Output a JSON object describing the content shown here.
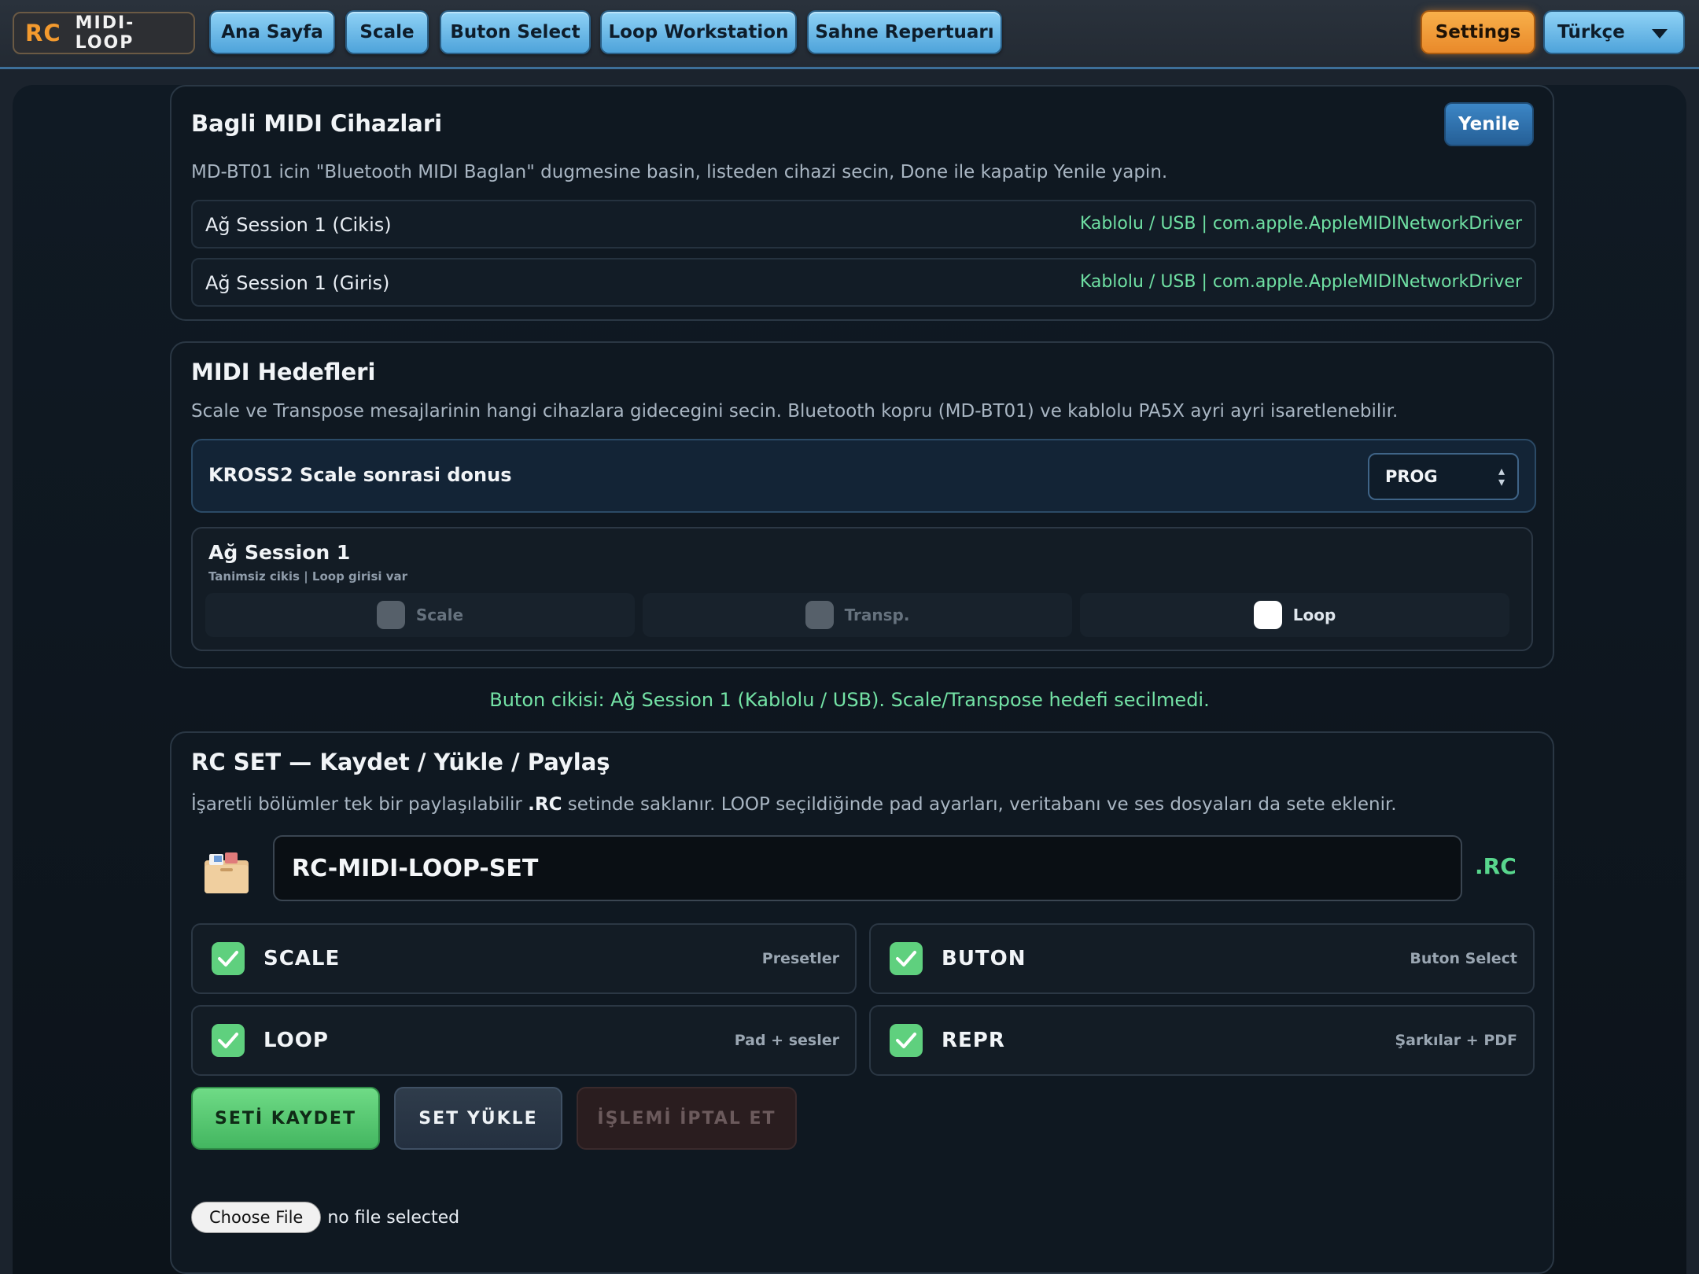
{
  "brand": {
    "logo": "RC",
    "name": "MIDI-LOOP"
  },
  "nav": {
    "items": [
      "Ana Sayfa",
      "Scale",
      "Buton Select",
      "Loop Workstation",
      "Sahne Repertuarı"
    ],
    "settings": "Settings",
    "language": "Türkçe"
  },
  "devices": {
    "title": "Bagli MIDI Cihazlari",
    "refresh": "Yenile",
    "hint": "MD-BT01 icin \"Bluetooth MIDI Baglan\" dugmesine basin, listeden cihazi secin, Done ile kapatip Yenile yapin.",
    "rows": [
      {
        "name": "Ağ Session 1 (Cikis)",
        "info": "Kablolu / USB | com.apple.AppleMIDINetworkDriver"
      },
      {
        "name": "Ağ Session 1 (Giris)",
        "info": "Kablolu / USB | com.apple.AppleMIDINetworkDriver"
      }
    ]
  },
  "targets": {
    "title": "MIDI Hedefleri",
    "desc": "Scale ve Transpose mesajlarinin hangi cihazlara gidecegini secin. Bluetooth kopru (MD-BT01) ve kablolu PA5X ayri ayri isaretlenebilir.",
    "kross_label": "KROSS2 Scale sonrasi donus",
    "kross_value": "PROG",
    "session_title": "Ağ Session 1",
    "session_sub": "Tanimsiz cikis | Loop girisi var",
    "options": [
      "Scale",
      "Transp.",
      "Loop"
    ]
  },
  "status": "Buton cikisi: Ağ Session 1 (Kablolu / USB). Scale/Transpose hedefi secilmedi.",
  "rcset": {
    "title": "RC SET — Kaydet / Yükle / Paylaş",
    "desc_pre": "İşaretli bölümler tek bir paylaşılabilir ",
    "desc_bold": ".RC",
    "desc_post": " setinde saklanır. LOOP seçildiğinde pad ayarları, veritabanı ve ses dosyaları da sete eklenir.",
    "set_name": "RC-MIDI-LOOP-SET",
    "ext": ".RC",
    "sections": [
      {
        "name": "SCALE",
        "hint": "Presetler",
        "checked": true
      },
      {
        "name": "BUTON",
        "hint": "Buton Select",
        "checked": true
      },
      {
        "name": "LOOP",
        "hint": "Pad + sesler",
        "checked": true
      },
      {
        "name": "REPR",
        "hint": "Şarkılar + PDF",
        "checked": true
      }
    ],
    "save": "SETİ KAYDET",
    "load": "SET YÜKLE",
    "cancel": "İŞLEMİ İPTAL ET",
    "choose_file": "Choose File",
    "no_file": "no file selected"
  },
  "colors": {
    "accent": "#4ea3da",
    "settings": "#f39a2e",
    "success": "#5fd07e",
    "info_green": "#6fe0a3"
  }
}
